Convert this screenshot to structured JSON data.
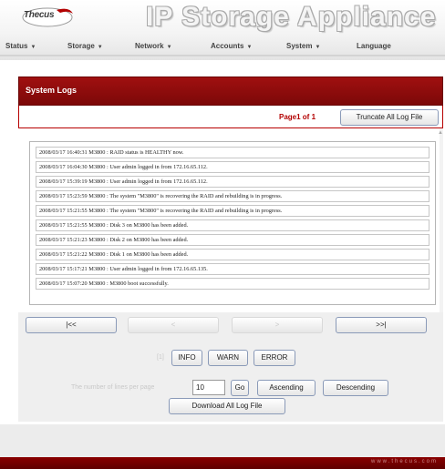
{
  "header": {
    "logo_text": "Thecus",
    "app_title": "IP Storage Appliance"
  },
  "menu": [
    {
      "label": "Status"
    },
    {
      "label": "Storage"
    },
    {
      "label": "Network"
    },
    {
      "label": "Accounts"
    },
    {
      "label": "System"
    },
    {
      "label": "Language"
    }
  ],
  "menu_caret_icon": "caret-down-icon",
  "panel": {
    "title": "System Logs",
    "page_info": "Page1 of 1",
    "truncate_label": "Truncate All Log File"
  },
  "logs": [
    "2008/03/17 16:40:31 M3800 : RAID status is HEALTHY now.",
    "2008/03/17 16:04:30 M3800 : User admin logged in from 172.16.65.112.",
    "2008/03/17 15:39:19 M3800 : User admin logged in from 172.16.65.112.",
    "2008/03/17 15:23:59 M3800 : The system \"M3800\" is recovering the RAID and rebuilding is in progress.",
    "2008/03/17 15:21:55 M3800 : The system \"M3800\" is recovering the RAID and rebuilding is in progress.",
    "2008/03/17 15:21:55 M3800 : Disk 3 on M3800 has been added.",
    "2008/03/17 15:21:23 M3800 : Disk 2 on M3800 has been added.",
    "2008/03/17 15:21:22 M3800 : Disk 1 on M3800 has been added.",
    "2008/03/17 15:17:21 M3800 : User admin logged in from 172.16.65.135.",
    "2008/03/17 15:07:20 M3800 : M3800 boot successfully."
  ],
  "nav": {
    "first": "|<<",
    "prev": "<",
    "next": ">",
    "last": ">>|"
  },
  "filter": {
    "label": "[1]",
    "info": "INFO",
    "warn": "WARN",
    "error": "ERROR"
  },
  "lines": {
    "label": "The number of lines per page",
    "value": "10",
    "go": "Go",
    "ascending": "Ascending",
    "descending": "Descending"
  },
  "download_label": "Download All Log File",
  "footer_url": "www.thecus.com",
  "colors": {
    "brand_red": "#8b0000",
    "panel_header": "#9a0e0e"
  }
}
